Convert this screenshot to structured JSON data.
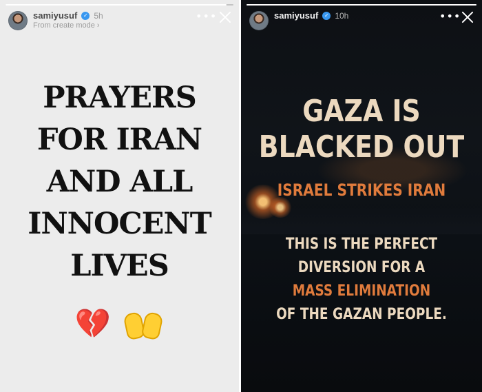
{
  "left_story": {
    "progress": 0.97,
    "username": "samiyusuf",
    "timestamp": "5h",
    "subtitle": "From create mode ›",
    "more_label": "•••",
    "lines": [
      "PRAYERS",
      "FOR IRAN",
      "AND ALL",
      "INNOCENT",
      "LIVES"
    ],
    "heart_emoji": "💔"
  },
  "right_story": {
    "progress": 1.0,
    "username": "samiyusuf",
    "timestamp": "10h",
    "more_label": "•••",
    "title_line_1": "GAZA IS",
    "title_line_2": "BLACKED OUT",
    "strikes_line": "ISRAEL STRIKES IRAN",
    "body_lines": [
      "THIS IS THE PERFECT",
      "DIVERSION FOR A",
      "MASS ELIMINATION",
      "OF THE GAZAN PEOPLE."
    ]
  },
  "colors": {
    "left_background": "#ececec",
    "right_background": "#0d1014",
    "title_cream": "#ecd9bf",
    "accent_orange": "#e07b3c",
    "verified_blue": "#3897f0"
  }
}
